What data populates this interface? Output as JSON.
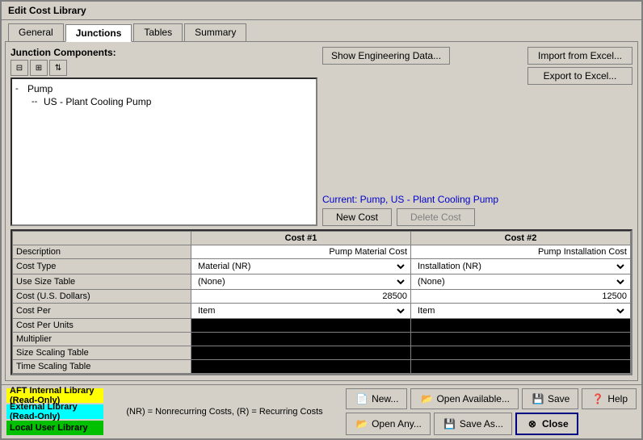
{
  "window": {
    "title": "Edit Cost Library"
  },
  "tabs": [
    {
      "id": "general",
      "label": "General",
      "active": false
    },
    {
      "id": "junctions",
      "label": "Junctions",
      "active": true
    },
    {
      "id": "tables",
      "label": "Tables",
      "active": false
    },
    {
      "id": "summary",
      "label": "Summary",
      "active": false
    }
  ],
  "junction": {
    "label": "Junction Components:",
    "tree": {
      "root": "Pump",
      "child": "US - Plant Cooling Pump"
    },
    "current_text": "Current: Pump, US - Plant Cooling Pump",
    "new_cost_label": "New Cost",
    "delete_cost_label": "Delete Cost"
  },
  "buttons": {
    "show_engineering": "Show Engineering Data...",
    "import_excel": "Import from Excel...",
    "export_excel": "Export to Excel..."
  },
  "cost_table": {
    "headers": [
      "",
      "Cost #1",
      "Cost #2"
    ],
    "rows": [
      {
        "label": "Description",
        "val1": "Pump Material Cost",
        "val2": "Pump Installation Cost"
      },
      {
        "label": "Cost Type",
        "val1": "Material (NR)",
        "val2": "Installation (NR)"
      },
      {
        "label": "Use Size Table",
        "val1": "(None)",
        "val2": "(None)"
      },
      {
        "label": "Cost (U.S. Dollars)",
        "val1": "28500",
        "val2": "12500"
      },
      {
        "label": "Cost Per",
        "val1": "Item",
        "val2": "Item"
      },
      {
        "label": "Cost Per Units",
        "val1": "",
        "val2": ""
      },
      {
        "label": "Multiplier",
        "val1": "",
        "val2": ""
      },
      {
        "label": "Size Scaling Table",
        "val1": "",
        "val2": ""
      },
      {
        "label": "Time Scaling Table",
        "val1": "",
        "val2": ""
      }
    ]
  },
  "footer": {
    "legends": [
      {
        "label": "AFT Internal Library (Read-Only)",
        "color": "yellow"
      },
      {
        "label": "External Library (Read-Only)",
        "color": "cyan"
      },
      {
        "label": "Local User Library",
        "color": "green"
      }
    ],
    "note": "(NR) = Nonrecurring Costs, (R) = Recurring Costs",
    "buttons": {
      "new": "New...",
      "open_available": "Open Available...",
      "open_any": "Open Any...",
      "save": "Save",
      "save_as": "Save As...",
      "help": "Help",
      "close": "Close"
    }
  }
}
